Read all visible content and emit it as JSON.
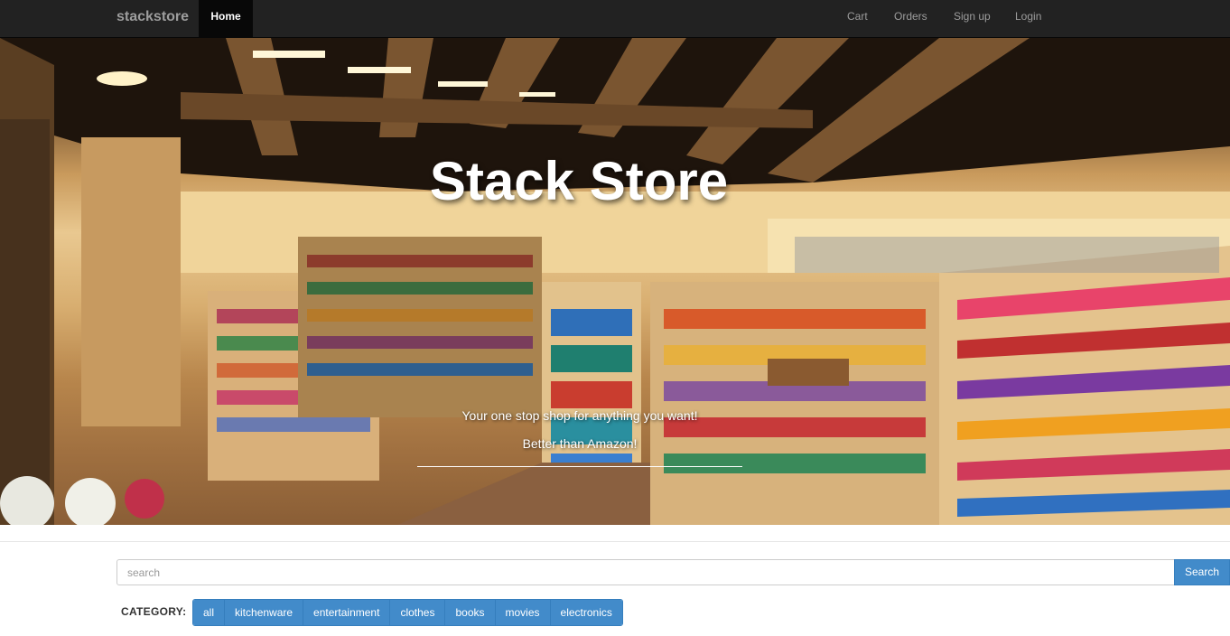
{
  "navbar": {
    "brand": "stackstore",
    "home": "Home",
    "cart": "Cart",
    "orders": "Orders",
    "signup": "Sign up",
    "login": "Login"
  },
  "hero": {
    "title": "Stack Store",
    "subtitle_1": "Your one stop shop for anything you want!",
    "subtitle_2": "Better than Amazon!"
  },
  "search": {
    "placeholder": "search",
    "button_label": "Search"
  },
  "category": {
    "label": "CATEGORY:",
    "options": [
      "all",
      "kitchenware",
      "entertainment",
      "clothes",
      "books",
      "movies",
      "electronics"
    ]
  },
  "colors": {
    "navbar_bg": "#222222",
    "primary": "#428bca"
  }
}
